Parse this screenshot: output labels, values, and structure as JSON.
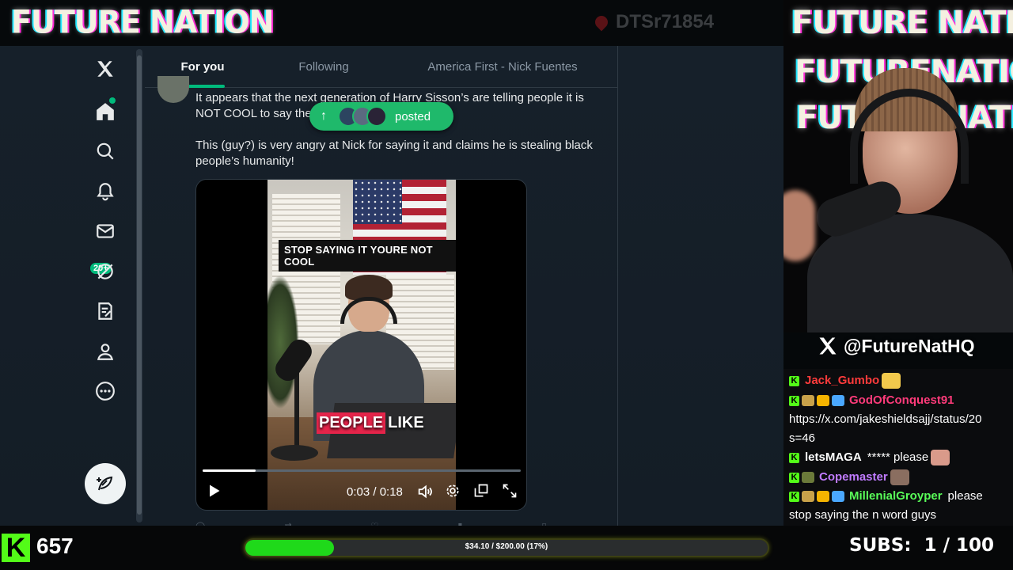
{
  "stream": {
    "banner_title": "FUTURE NATION",
    "banner_user": "DTSr71854",
    "handle": "@FutureNatHQ",
    "viewers": "657",
    "goal_text": "$34.10 / $200.00 (17%)",
    "goal_progress": 0.17,
    "subs_label": "SUBS:",
    "subs_value": "1 / 100"
  },
  "x_app": {
    "nav": [
      {
        "icon": "x-logo-icon"
      },
      {
        "icon": "home-icon"
      },
      {
        "icon": "search-icon"
      },
      {
        "icon": "notifications-bell-icon"
      },
      {
        "icon": "messages-icon",
        "badge": "20+"
      },
      {
        "icon": "grok-icon"
      },
      {
        "icon": "lists-icon"
      },
      {
        "icon": "profile-icon"
      },
      {
        "icon": "more-icon"
      },
      {
        "icon": "post-compose-icon"
      }
    ],
    "tabs": [
      {
        "label": "For you",
        "active": true
      },
      {
        "label": "Following",
        "active": false
      },
      {
        "label": "America First - Nick Fuentes",
        "active": false
      }
    ],
    "new_posts_pill": "posted",
    "post": {
      "text_line1": "It appears that the next generation of Harry Sisson’s are telling people it is",
      "text_line2": "NOT COOL to say the",
      "text_para2_line1": "This (guy?) is very angry at Nick for saying it and claims he is stealing black",
      "text_para2_line2": "people’s humanity!",
      "video_caption_top": "STOP SAYING IT YOURE NOT COOL",
      "video_caption_bottom_1": "PEOPLE",
      "video_caption_bottom_2": "LIKE",
      "video_time": "0:03 / 0:18",
      "video_progress": 0.167
    }
  },
  "camera_overlay": {
    "words": [
      "FUTURE NATION",
      "FUTURENATION",
      "FUTURE NATION"
    ]
  },
  "chat": [
    {
      "badges": [
        "kick"
      ],
      "user": "Jack_Gumbo",
      "user_color": "#ff3b3b",
      "message": "",
      "emote": true
    },
    {
      "badges": [
        "kick",
        "sub",
        "crown",
        "sword"
      ],
      "user": "GodOfConquest91",
      "user_color": "#ff3b7a",
      "message": ""
    },
    {
      "badges": [],
      "user": "",
      "user_color": "#ffffff",
      "message": "https://x.com/jakeshieldsajj/status/20"
    },
    {
      "badges": [],
      "user": "",
      "user_color": "#ffffff",
      "message": "s=46"
    },
    {
      "badges": [
        "kick"
      ],
      "user": "letsMAGA",
      "user_color": "#ffffff",
      "message": "***** please",
      "emote": true
    },
    {
      "badges": [
        "kick",
        "soldier"
      ],
      "user": "Copemaster",
      "user_color": "#c07bff",
      "message": "",
      "emote": true
    },
    {
      "badges": [
        "kick",
        "sub",
        "crown",
        "sword"
      ],
      "user": "MillenialGroyper",
      "user_color": "#59ff59",
      "message": "please"
    },
    {
      "badges": [],
      "user": "",
      "user_color": "#ffffff",
      "message": "stop saying the n word guys"
    }
  ]
}
